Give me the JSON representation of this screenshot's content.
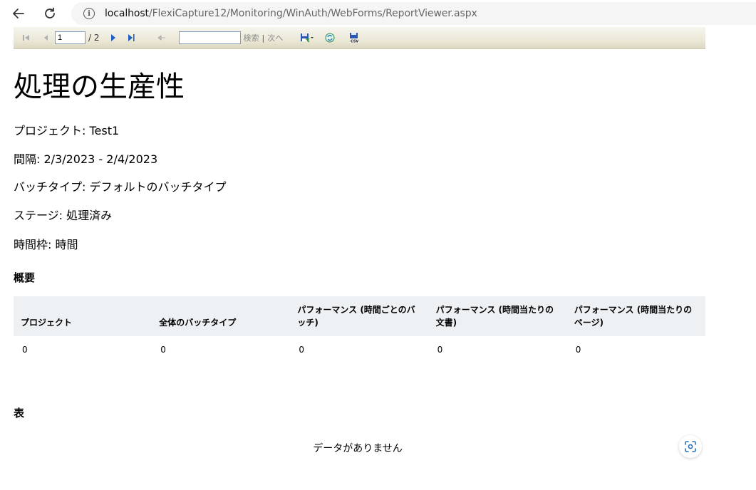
{
  "browser": {
    "url_host": "localhost",
    "url_path": "/FlexiCapture12/Monitoring/WinAuth/WebForms/ReportViewer.aspx"
  },
  "toolbar": {
    "current_page": "1",
    "page_total": "/ 2",
    "find_label": "検索",
    "find_separator": "|",
    "find_next_label": "次へ"
  },
  "report": {
    "title": "処理の生産性",
    "params": {
      "project": "プロジェクト: Test1",
      "interval": "間隔: 2/3/2023 - 2/4/2023",
      "batch_type": "バッチタイプ: デフォルトのバッチタイプ",
      "stage": "ステージ: 処理済み",
      "time_frame": "時間枠: 時間"
    },
    "summary": {
      "heading": "概要",
      "columns": [
        "プロジェクト",
        "全体のバッチタイプ",
        "パフォーマンス (時間ごとのバッチ)",
        "パフォーマンス (時間当たりの文書)",
        "パフォーマンス (時間当たりのページ)"
      ],
      "row": [
        "0",
        "0",
        "0",
        "0",
        "0"
      ]
    },
    "table": {
      "heading": "表",
      "empty_message": "データがありません"
    }
  }
}
